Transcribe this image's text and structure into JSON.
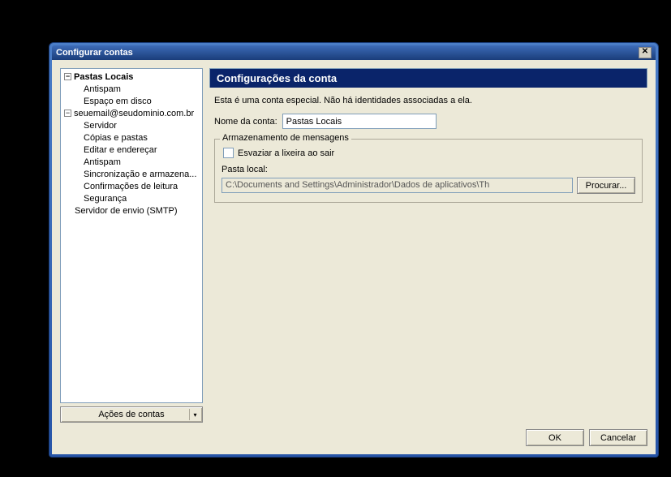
{
  "window": {
    "title": "Configurar contas",
    "close": "✕"
  },
  "sidebar": {
    "items": [
      {
        "label": "Pastas Locais",
        "type": "root"
      },
      {
        "label": "Antispam",
        "type": "child"
      },
      {
        "label": "Espaço em disco",
        "type": "child"
      },
      {
        "label": "seuemail@seudominio.com.br",
        "type": "root"
      },
      {
        "label": "Servidor",
        "type": "child"
      },
      {
        "label": "Cópias e pastas",
        "type": "child"
      },
      {
        "label": "Editar e endereçar",
        "type": "child"
      },
      {
        "label": "Antispam",
        "type": "child"
      },
      {
        "label": "Sincronização e armazena...",
        "type": "child"
      },
      {
        "label": "Confirmações de leitura",
        "type": "child"
      },
      {
        "label": "Segurança",
        "type": "child"
      },
      {
        "label": "Servidor de envio (SMTP)",
        "type": "root-plain"
      }
    ],
    "actions_label": "Ações de contas"
  },
  "panel": {
    "title": "Configurações da conta",
    "description": "Esta é uma conta especial. Não há identidades associadas a ela.",
    "account_name_label": "Nome da conta:",
    "account_name_value": "Pastas Locais",
    "storage": {
      "legend": "Armazenamento de mensagens",
      "empty_trash_label": "Esvaziar a lixeira ao sair",
      "local_folder_label": "Pasta local:",
      "local_folder_value": "C:\\Documents and Settings\\Administrador\\Dados de aplicativos\\Th",
      "browse_label": "Procurar..."
    }
  },
  "footer": {
    "ok": "OK",
    "cancel": "Cancelar"
  }
}
